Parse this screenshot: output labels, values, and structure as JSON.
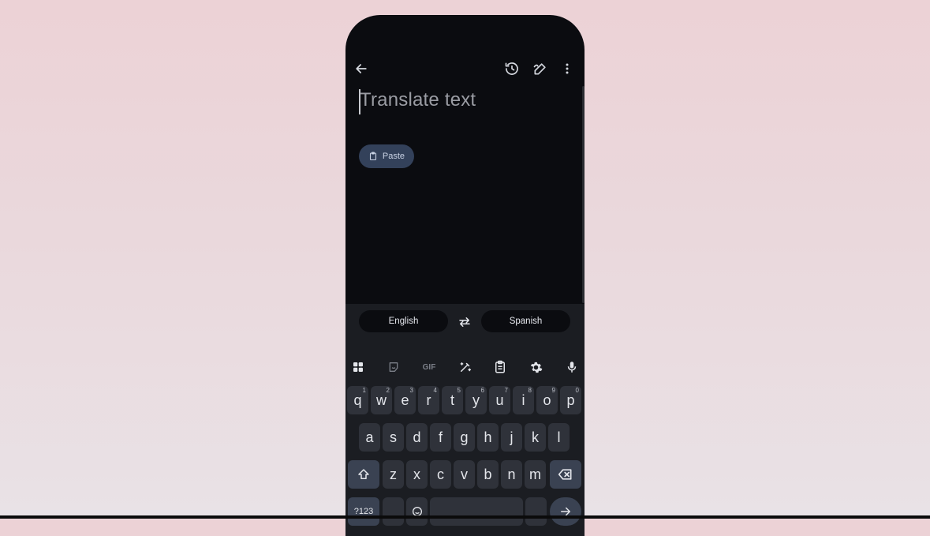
{
  "input": {
    "placeholder": "Translate text"
  },
  "paste": {
    "label": "Paste"
  },
  "languages": {
    "source": "English",
    "target": "Spanish"
  },
  "toolbar": {
    "gif_label": "GIF"
  },
  "keyboard": {
    "row1": [
      {
        "k": "q",
        "h": "1"
      },
      {
        "k": "w",
        "h": "2"
      },
      {
        "k": "e",
        "h": "3"
      },
      {
        "k": "r",
        "h": "4"
      },
      {
        "k": "t",
        "h": "5"
      },
      {
        "k": "y",
        "h": "6"
      },
      {
        "k": "u",
        "h": "7"
      },
      {
        "k": "i",
        "h": "8"
      },
      {
        "k": "o",
        "h": "9"
      },
      {
        "k": "p",
        "h": "0"
      }
    ],
    "row2": [
      "a",
      "s",
      "d",
      "f",
      "g",
      "h",
      "j",
      "k",
      "l"
    ],
    "row3": [
      "z",
      "x",
      "c",
      "v",
      "b",
      "n",
      "m"
    ],
    "symbols_label": "?123"
  },
  "colors": {
    "accent_chip": "#33415a",
    "surface": "#1b1d22",
    "background": "#0b0c10"
  }
}
